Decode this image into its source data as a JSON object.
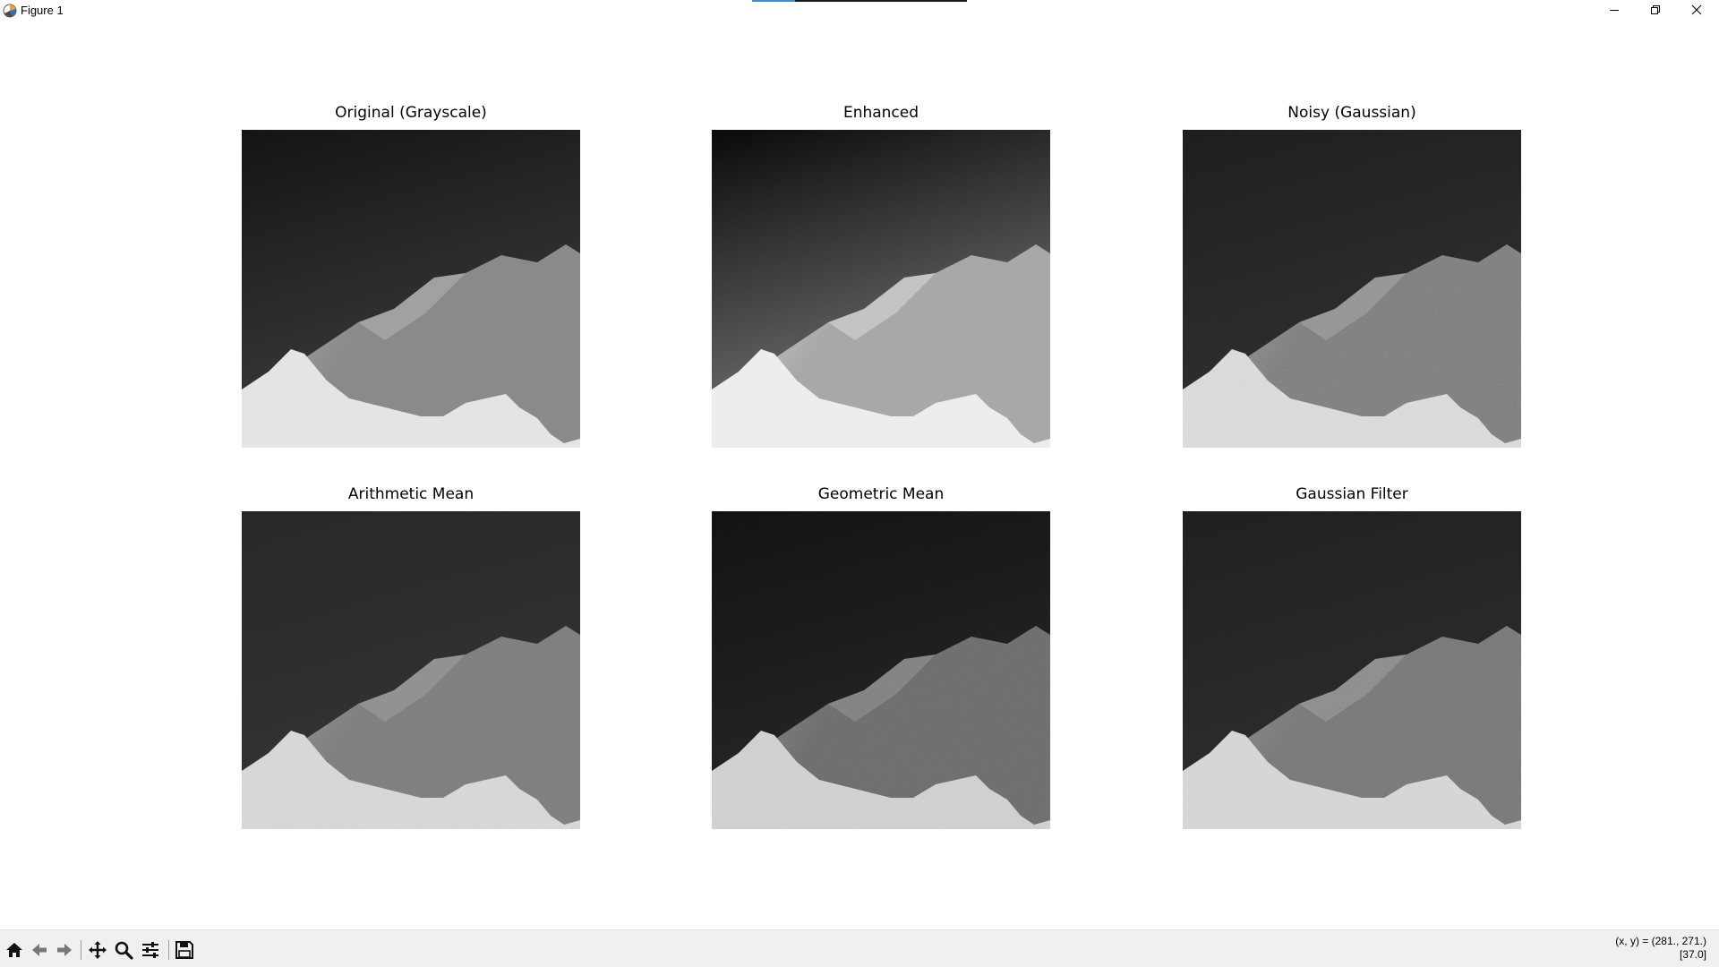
{
  "window": {
    "title": "Figure 1",
    "controls": {
      "minimize": "minimize",
      "maximize": "restore",
      "close": "close"
    }
  },
  "figure": {
    "subplots": [
      {
        "title": "Original (Grayscale)",
        "variant": "original"
      },
      {
        "title": "Enhanced",
        "variant": "enhanced"
      },
      {
        "title": "Noisy (Gaussian)",
        "variant": "noisy"
      },
      {
        "title": "Arithmetic Mean",
        "variant": "arith"
      },
      {
        "title": "Geometric Mean",
        "variant": "geom"
      },
      {
        "title": "Gaussian Filter",
        "variant": "gauss"
      }
    ]
  },
  "toolbar": {
    "tools": [
      "home-icon",
      "back-icon",
      "forward-icon",
      "pan-icon",
      "zoom-icon",
      "configure-subplots-icon",
      "save-icon"
    ],
    "coords_line1": "(x, y) = (281., 271.)",
    "coords_line2": "[37.0]"
  },
  "colors": {
    "toolbar_bg": "#f0f0f0",
    "accent_blue": "#3b8fd8"
  }
}
